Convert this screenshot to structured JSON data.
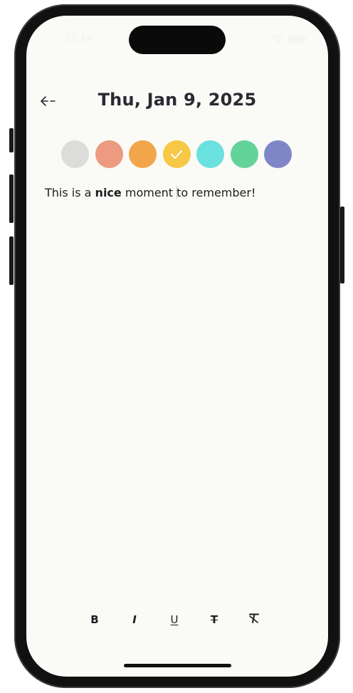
{
  "status_bar": {
    "time": "11:14"
  },
  "header": {
    "title": "Thu, Jan 9, 2025",
    "back_icon": "arrow-left-icon"
  },
  "colors": [
    {
      "name": "gray",
      "hex": "#dcdddb",
      "selected": false
    },
    {
      "name": "salmon",
      "hex": "#ec9a80",
      "selected": false
    },
    {
      "name": "orange",
      "hex": "#f2a64c",
      "selected": false
    },
    {
      "name": "yellow",
      "hex": "#f7c746",
      "selected": true
    },
    {
      "name": "cyan",
      "hex": "#6ae0df",
      "selected": false
    },
    {
      "name": "green",
      "hex": "#63d39a",
      "selected": false
    },
    {
      "name": "indigo",
      "hex": "#7f86c8",
      "selected": false
    }
  ],
  "note": {
    "before": "This is a ",
    "bold": "nice",
    "middle": " moment ",
    "after": "to remember!"
  },
  "format_toolbar": {
    "bold_label": "B",
    "italic_label": "I",
    "underline_label": "U",
    "strikethrough_label": "T",
    "clear_icon": "clear-format-icon"
  }
}
